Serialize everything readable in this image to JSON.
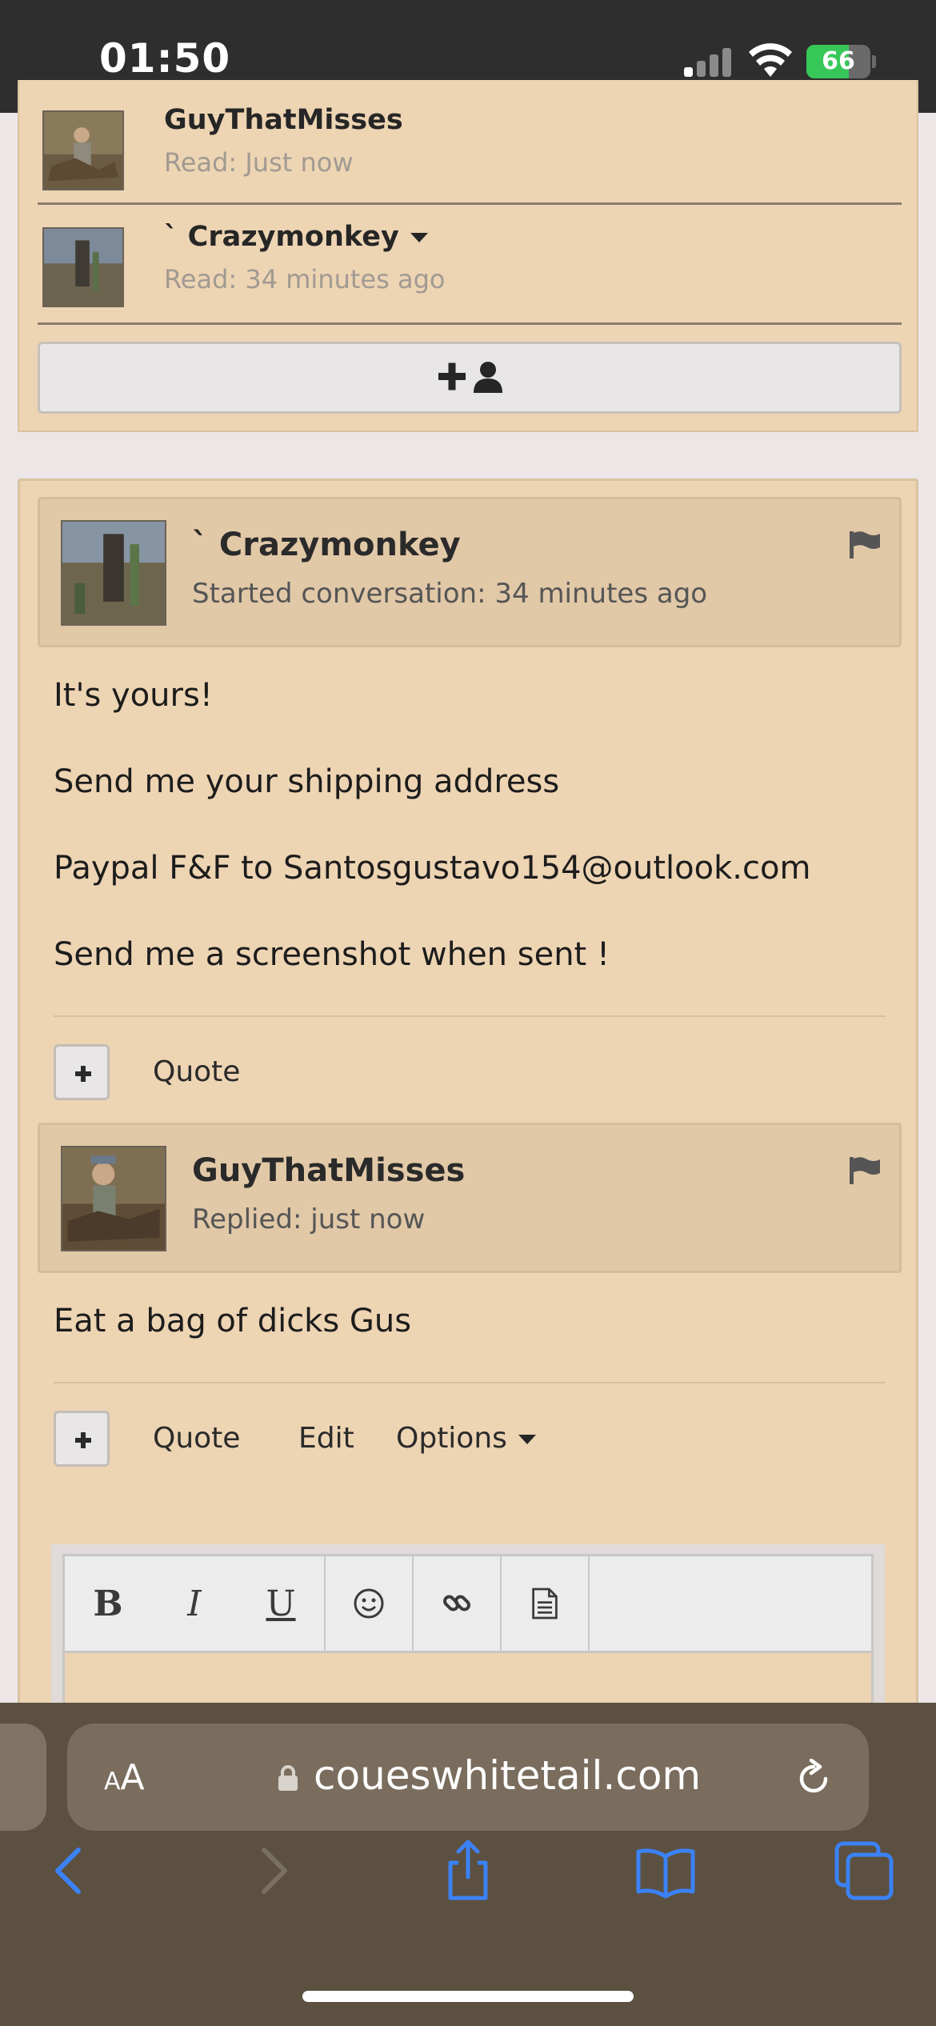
{
  "status_bar": {
    "time": "01:50",
    "battery_percent": "66",
    "battery_level": 0.66
  },
  "participants": [
    {
      "name": "GuyThatMisses",
      "read": "Read: Just now",
      "has_menu": false
    },
    {
      "name": "` Crazymonkey",
      "read": "Read: 34 minutes ago",
      "has_menu": true
    }
  ],
  "add_participant_icon": "add-user-icon",
  "messages": [
    {
      "author": "` Crazymonkey",
      "meta": "Started conversation: 34 minutes ago",
      "lines": [
        "It's yours!",
        "Send me your shipping address",
        "Paypal F&F to Santosgustavo154@outlook.com",
        "Send me a screenshot when sent !"
      ],
      "actions": {
        "quote": "Quote"
      }
    },
    {
      "author": "GuyThatMisses",
      "meta": "Replied: just now",
      "lines": [
        "Eat a bag of dicks Gus"
      ],
      "actions": {
        "quote": "Quote",
        "edit": "Edit",
        "options": "Options"
      }
    }
  ],
  "editor_toolbar": {
    "bold": "B",
    "italic": "I",
    "underline": "U",
    "icons": [
      "bold-icon",
      "italic-icon",
      "underline-icon",
      "emoji-icon",
      "link-icon",
      "document-icon"
    ]
  },
  "browser": {
    "text_size": "AA",
    "url": "coueswhitetail.com"
  },
  "colors": {
    "panel_bg": "#edd4b3",
    "header_bg": "#e1c8a7",
    "safari_bar": "#5c5040",
    "ios_blue": "#3b82f6"
  }
}
